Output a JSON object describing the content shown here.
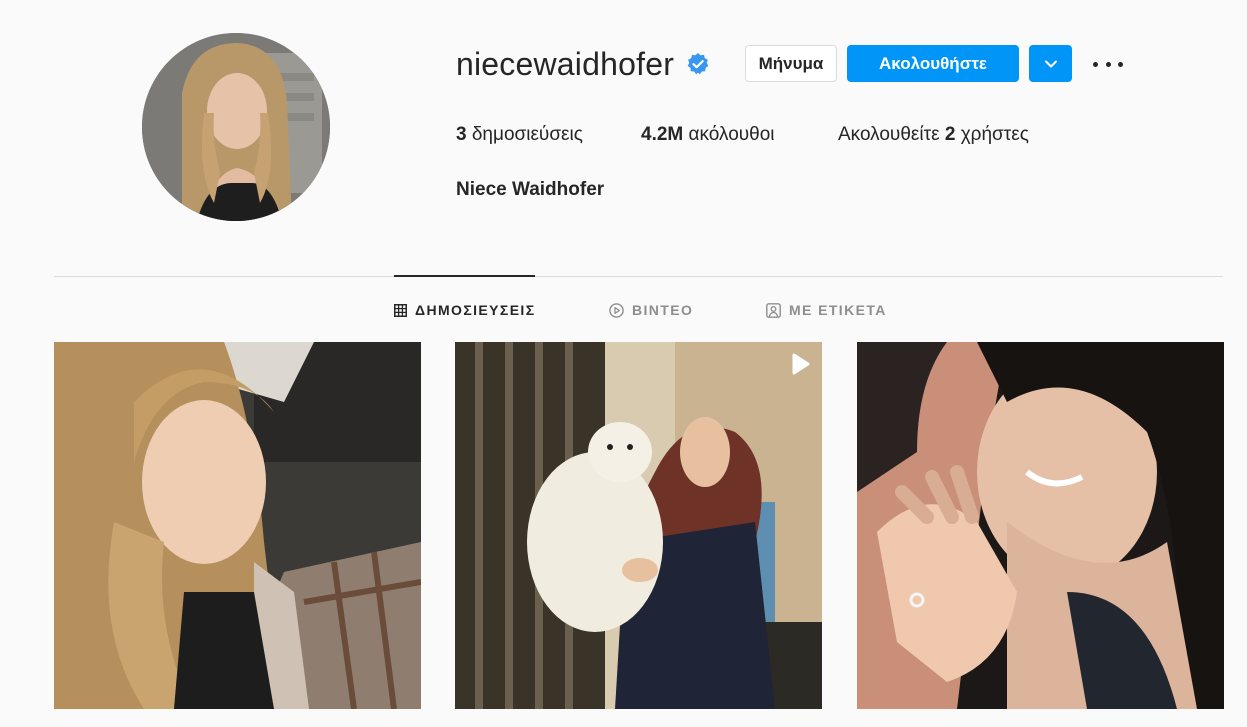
{
  "profile": {
    "username": "niecewaidhofer",
    "verified": true,
    "full_name": "Niece Waidhofer",
    "avatar_icon": "profile-photo"
  },
  "actions": {
    "message_label": "Μήνυμα",
    "follow_label": "Ακολουθήστε",
    "dropdown_icon": "chevron-down-icon",
    "more_icon": "more-options-icon"
  },
  "stats": {
    "posts_count": "3",
    "posts_label": "δημοσιεύσεις",
    "followers_count": "4.2M",
    "followers_label": "ακόλουθοι",
    "following_prefix": "Ακολουθείτε",
    "following_count": "2",
    "following_suffix": "χρήστες"
  },
  "tabs": [
    {
      "label": "ΔΗΜΟΣΙΕΥΣΕΙΣ",
      "icon": "grid-icon",
      "active": true
    },
    {
      "label": "ΒΙΝΤΕΟ",
      "icon": "play-circle-icon",
      "active": false
    },
    {
      "label": "ΜΕ ΕΤΙΚΕΤΑ",
      "icon": "tagged-user-icon",
      "active": false
    }
  ],
  "posts": [
    {
      "type": "image"
    },
    {
      "type": "video",
      "badge_icon": "video-play-icon"
    },
    {
      "type": "image"
    }
  ],
  "colors": {
    "accent": "#0095f6",
    "background": "#fafafa",
    "text": "#262626",
    "muted": "#8e8e8e",
    "border": "#dbdbdb"
  }
}
